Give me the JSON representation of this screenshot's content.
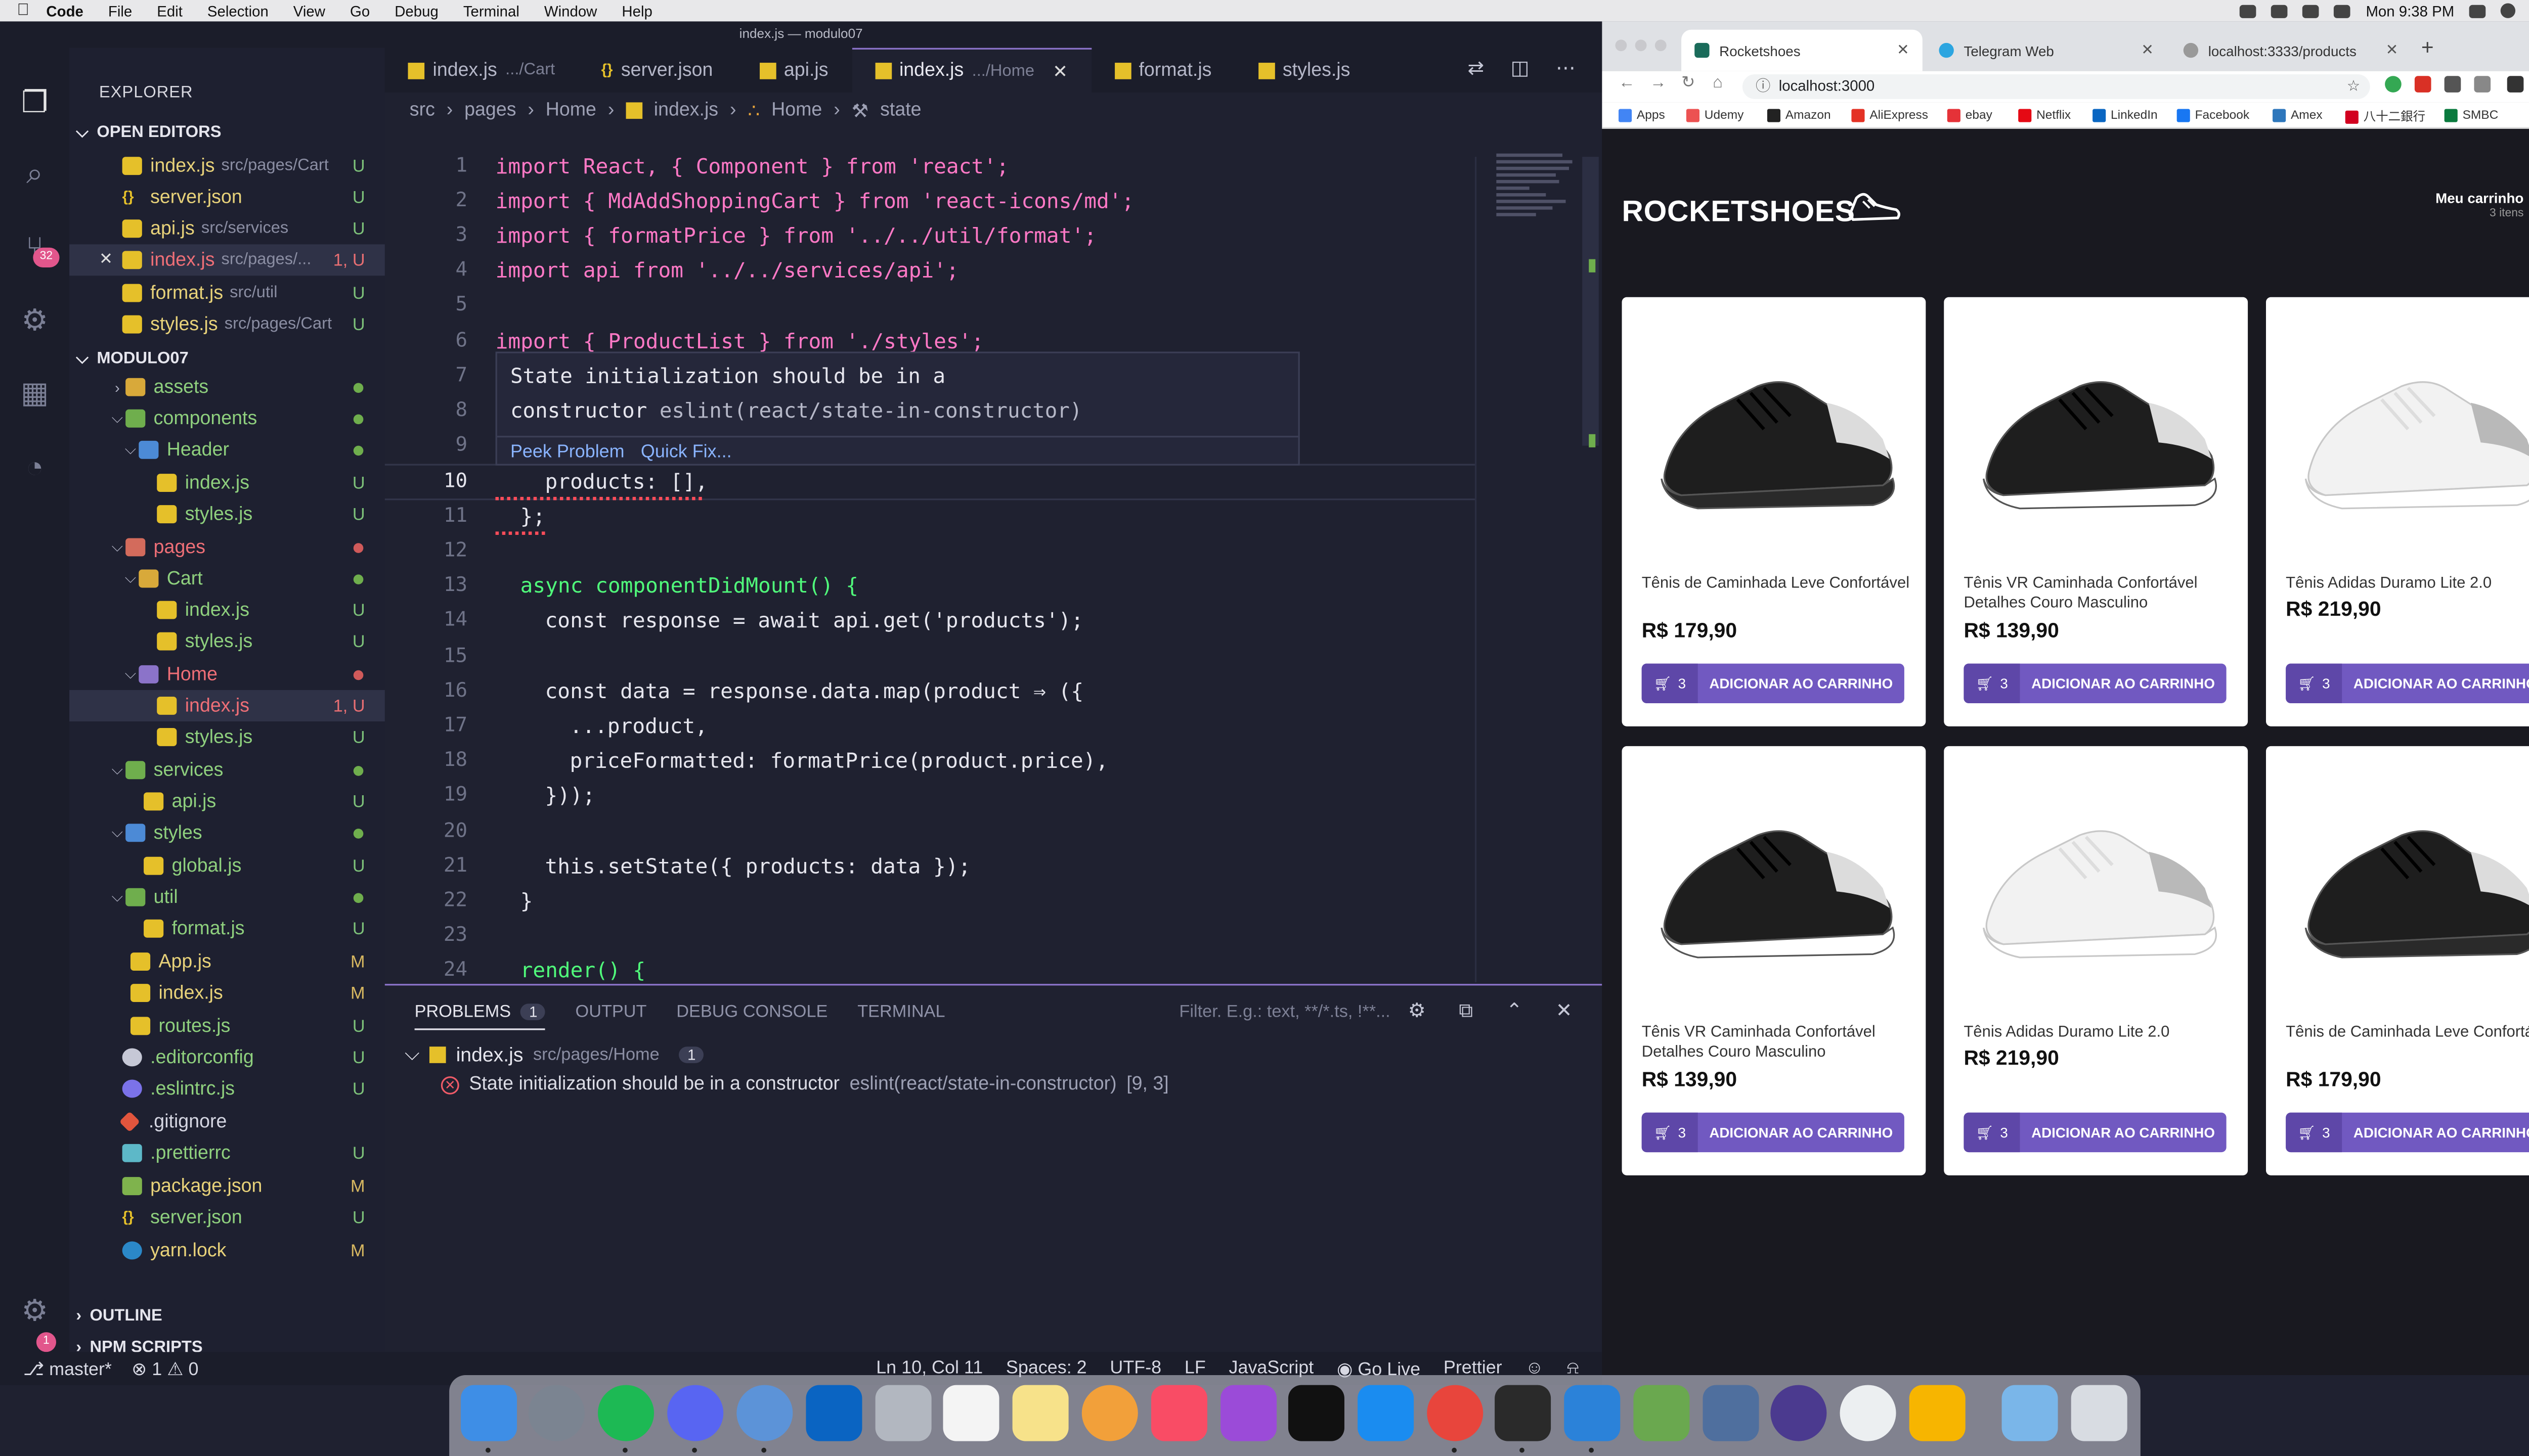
{
  "menubar": {
    "app": "Code",
    "items": [
      "File",
      "Edit",
      "Selection",
      "View",
      "Go",
      "Debug",
      "Terminal",
      "Window",
      "Help"
    ],
    "clock": "Mon 9:38 PM"
  },
  "vscode": {
    "window_title": "index.js — modulo07",
    "scm_badge": "32",
    "settings_badge": "1",
    "explorer_title": "EXPLORER",
    "open_editors_label": "OPEN EDITORS",
    "open_editors": [
      {
        "name": "index.js",
        "path": "src/pages/Cart",
        "status": "U"
      },
      {
        "name": "server.json",
        "path": "",
        "status": "U"
      },
      {
        "name": "api.js",
        "path": "src/services",
        "status": "U"
      },
      {
        "name": "index.js",
        "path": "src/pages/...",
        "status": "1, U"
      },
      {
        "name": "format.js",
        "path": "src/util",
        "status": "U"
      },
      {
        "name": "styles.js",
        "path": "src/pages/Cart",
        "status": "U"
      }
    ],
    "project_label": "MODULO07",
    "tree": [
      {
        "name": "assets"
      },
      {
        "name": "components"
      },
      {
        "name": "Header"
      },
      {
        "name": "index.js",
        "status": "U"
      },
      {
        "name": "styles.js",
        "status": "U"
      },
      {
        "name": "pages"
      },
      {
        "name": "Cart"
      },
      {
        "name": "index.js",
        "status": "U"
      },
      {
        "name": "styles.js",
        "status": "U"
      },
      {
        "name": "Home"
      },
      {
        "name": "index.js",
        "status": "1, U"
      },
      {
        "name": "styles.js",
        "status": "U"
      },
      {
        "name": "services"
      },
      {
        "name": "api.js",
        "status": "U"
      },
      {
        "name": "styles"
      },
      {
        "name": "global.js",
        "status": "U"
      },
      {
        "name": "util"
      },
      {
        "name": "format.js",
        "status": "U"
      },
      {
        "name": "App.js",
        "status": "M"
      },
      {
        "name": "index.js",
        "status": "M"
      },
      {
        "name": "routes.js",
        "status": "U"
      },
      {
        "name": ".editorconfig",
        "status": "U"
      },
      {
        "name": ".eslintrc.js",
        "status": "U"
      },
      {
        "name": ".gitignore",
        "status": ""
      },
      {
        "name": ".prettierrc",
        "status": "U"
      },
      {
        "name": "package.json",
        "status": "M"
      },
      {
        "name": "server.json",
        "status": "U"
      },
      {
        "name": "yarn.lock",
        "status": "M"
      }
    ],
    "outline_label": "OUTLINE",
    "npm_label": "NPM SCRIPTS",
    "tabs": [
      {
        "name": "index.js",
        "sub": ".../Cart"
      },
      {
        "name": "server.json",
        "sub": ""
      },
      {
        "name": "api.js",
        "sub": ""
      },
      {
        "name": "index.js",
        "sub": ".../Home"
      },
      {
        "name": "format.js",
        "sub": ""
      },
      {
        "name": "styles.js",
        "sub": ""
      }
    ],
    "breadcrumb": [
      "src",
      "pages",
      "Home",
      "index.js",
      "Home",
      "state"
    ],
    "line_numbers": [
      "1",
      "2",
      "3",
      "4",
      "5",
      "6",
      "7",
      "8",
      "9",
      "10",
      "11",
      "12",
      "13",
      "14",
      "15",
      "16",
      "17",
      "18",
      "19",
      "20",
      "21",
      "22",
      "23",
      "24"
    ],
    "code": {
      "l1": "import React, { Component } from 'react';",
      "l2": "import { MdAddShoppingCart } from 'react-icons/md';",
      "l3": "import { formatPrice } from '../../util/format';",
      "l4": "import api from '../../services/api';",
      "l6": "import { ProductList } from './styles';",
      "l10": "products: [],",
      "l11": "};",
      "l13": "async componentDidMount() {",
      "l14": "const response = await api.get('products');",
      "l16": "const data = response.data.map(product ⇒ ({",
      "l17": "...product,",
      "l18": "priceFormatted: formatPrice(product.price),",
      "l19": "}));",
      "l21": "this.setState({ products: data });",
      "l22": "}",
      "l24": "render() {"
    },
    "hover": {
      "message_line1": "State initialization should be in a",
      "message_line2": "constructor",
      "rule": "eslint(react/state-in-constructor)",
      "peek": "Peek Problem",
      "quickfix": "Quick Fix..."
    },
    "panel": {
      "tabs": [
        "PROBLEMS",
        "OUTPUT",
        "DEBUG CONSOLE",
        "TERMINAL"
      ],
      "problem_count": "1",
      "filter_placeholder": "Filter. E.g.: text, **/*.ts, !**...",
      "file": "index.js",
      "file_path": "src/pages/Home",
      "file_count": "1",
      "error_message": "State initialization should be in a constructor",
      "error_rule": "eslint(react/state-in-constructor)",
      "error_pos": "[9, 3]"
    },
    "status": {
      "branch": "master*",
      "errors": "1",
      "warnings": "0",
      "position": "Ln 10, Col 11",
      "spaces": "Spaces: 2",
      "encoding": "UTF-8",
      "eol": "LF",
      "language": "JavaScript",
      "live": "Go Live",
      "formatter": "Prettier"
    }
  },
  "chrome": {
    "tabs": [
      "Rocketshoes",
      "Telegram Web",
      "localhost:3333/products"
    ],
    "url": "localhost:3000",
    "bookmarks": [
      "Apps",
      "Udemy",
      "Amazon",
      "AliExpress",
      "ebay",
      "Netflix",
      "LinkedIn",
      "Facebook",
      "Amex",
      "八十二銀行",
      "SMBC"
    ]
  },
  "store": {
    "logo": "ROCKETSHOES",
    "cart_label": "Meu carrinho",
    "cart_count": "3 itens",
    "products": [
      {
        "name": "Tênis de Caminhada Leve Confortável",
        "price": "R$ 179,90",
        "amount": "3",
        "button": "ADICIONAR AO CARRINHO",
        "style": "black"
      },
      {
        "name": "Tênis VR Caminhada Confortável Detalhes Couro Masculino",
        "price": "R$ 139,90",
        "amount": "3",
        "button": "ADICIONAR AO CARRINHO",
        "style": "blackwhite"
      },
      {
        "name": "Tênis Adidas Duramo Lite 2.0",
        "price": "R$ 219,90",
        "amount": "3",
        "button": "ADICIONAR AO CARRINHO",
        "style": "white"
      },
      {
        "name": "Tênis VR Caminhada Confortável Detalhes Couro Masculino",
        "price": "R$ 139,90",
        "amount": "3",
        "button": "ADICIONAR AO CARRINHO",
        "style": "blackwhite"
      },
      {
        "name": "Tênis Adidas Duramo Lite 2.0",
        "price": "R$ 219,90",
        "amount": "3",
        "button": "ADICIONAR AO CARRINHO",
        "style": "white"
      },
      {
        "name": "Tênis de Caminhada Leve Confortável",
        "price": "R$ 179,90",
        "amount": "3",
        "button": "ADICIONAR AO CARRINHO",
        "style": "black"
      }
    ]
  },
  "colors": {
    "accent": "#7159c1",
    "editor_bg": "#1f2130",
    "store_bg": "#191920"
  }
}
